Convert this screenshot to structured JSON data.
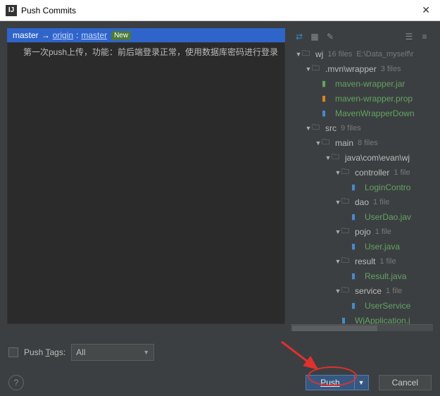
{
  "window": {
    "title": "Push Commits",
    "icon_letter": "IJ"
  },
  "branch": {
    "local": "master",
    "arrow": "→",
    "remote_name": "origin",
    "colon": ":",
    "remote_branch": "master",
    "new_tag": "New"
  },
  "commit": {
    "message": "第一次push上传，功能：前后端登录正常，使用数据库密码进行登录"
  },
  "tree": [
    {
      "depth": 0,
      "arrow": "▼",
      "icon": "folder",
      "label": "wj",
      "count": "16 files",
      "path": "E:\\Data_myself\\r",
      "green": false
    },
    {
      "depth": 1,
      "arrow": "▼",
      "icon": "folder",
      "label": ".mvn\\wrapper",
      "count": "3 files",
      "green": false
    },
    {
      "depth": 2,
      "arrow": "",
      "icon": "file",
      "label": "maven-wrapper.jar",
      "green": true
    },
    {
      "depth": 2,
      "arrow": "",
      "icon": "file2",
      "label": "maven-wrapper.prop",
      "green": true
    },
    {
      "depth": 2,
      "arrow": "",
      "icon": "file3",
      "label": "MavenWrapperDown",
      "green": true
    },
    {
      "depth": 1,
      "arrow": "▼",
      "icon": "folder",
      "label": "src",
      "count": "9 files",
      "green": false
    },
    {
      "depth": 2,
      "arrow": "▼",
      "icon": "folder",
      "label": "main",
      "count": "8 files",
      "green": false
    },
    {
      "depth": 3,
      "arrow": "▼",
      "icon": "folder",
      "label": "java\\com\\evan\\wj",
      "green": false
    },
    {
      "depth": 4,
      "arrow": "▼",
      "icon": "folder",
      "label": "controller",
      "count": "1 file",
      "green": false
    },
    {
      "depth": 5,
      "arrow": "",
      "icon": "file3",
      "label": "LoginContro",
      "green": true
    },
    {
      "depth": 4,
      "arrow": "▼",
      "icon": "folder",
      "label": "dao",
      "count": "1 file",
      "green": false
    },
    {
      "depth": 5,
      "arrow": "",
      "icon": "file3",
      "label": "UserDao.jav",
      "green": true
    },
    {
      "depth": 4,
      "arrow": "▼",
      "icon": "folder",
      "label": "pojo",
      "count": "1 file",
      "green": false
    },
    {
      "depth": 5,
      "arrow": "",
      "icon": "file3",
      "label": "User.java",
      "green": true
    },
    {
      "depth": 4,
      "arrow": "▼",
      "icon": "folder",
      "label": "result",
      "count": "1 file",
      "green": false
    },
    {
      "depth": 5,
      "arrow": "",
      "icon": "file3",
      "label": "Result.java",
      "green": true
    },
    {
      "depth": 4,
      "arrow": "▼",
      "icon": "folder",
      "label": "service",
      "count": "1 file",
      "green": false
    },
    {
      "depth": 5,
      "arrow": "",
      "icon": "file3",
      "label": "UserService",
      "green": true
    },
    {
      "depth": 4,
      "arrow": "",
      "icon": "file3",
      "label": "WjApplication.j",
      "green": true
    }
  ],
  "footer": {
    "push_tags_label_pre": "Push ",
    "push_tags_label_u": "T",
    "push_tags_label_post": "ags:",
    "tags_select": "All",
    "push_btn_u": "P",
    "push_btn_rest": "ush",
    "cancel": "Cancel"
  }
}
